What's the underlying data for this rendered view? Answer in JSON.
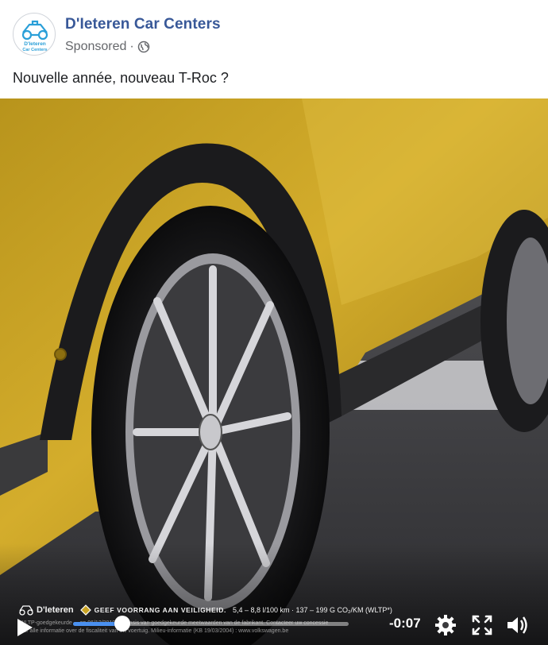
{
  "post": {
    "page_name": "D'Ieteren Car Centers",
    "sponsored_label": "Sponsored",
    "separator": "·",
    "audience_icon": "globe-icon",
    "text": "Nouvelle année, nouveau T-Roc ?",
    "avatar": {
      "icon": "car-logo-icon",
      "line1": "D'Ieteren",
      "line2": "Car Centers",
      "color": "#2a9fd8"
    }
  },
  "video": {
    "overlay": {
      "brand": "D'Ieteren",
      "safety_text": "GEEF VOORRANG AAN VEILIGHEID.",
      "consumption_text": "5,4 – 8,8 l/100 km · 137 – 199 G CO₂/KM (WLTP*)",
      "fine_print_line1": "*WLTP-goedgekeurde ... op 06/12/2019, op basis van goedgekeurde meetwaarden van de fabrikant. Contacteer uw concessie",
      "fine_print_line2": "voor alle informatie over de fiscaliteit van uw voertuig. Milieu-informatie (KB 19/03/2004) : www.volkswagen.be"
    },
    "controls": {
      "time_remaining": "-0:07",
      "progress": 0.18,
      "play_icon": "play-icon",
      "settings_icon": "gear-icon",
      "fullscreen_icon": "fullscreen-icon",
      "volume_icon": "volume-icon"
    }
  },
  "colors": {
    "page_name": "#385898",
    "secondary_text": "#65676b",
    "progress_fill": "#4a90f0",
    "car_body": "#c9a323"
  }
}
